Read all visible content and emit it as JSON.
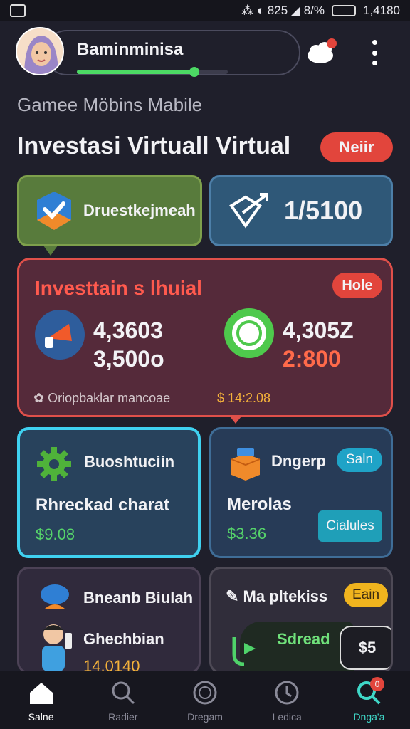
{
  "status_bar": {
    "icons_text": "⁂ ◐ 825 ◢ 8/%",
    "time": "1,4180"
  },
  "profile": {
    "name": "Baminminisa",
    "xp_progress": 0.78,
    "avatar_icon": "hijab-avatar"
  },
  "header": {
    "subtitle": "Gamee Möbins Mabile",
    "section_title": "Investasi Virtuall Virtual",
    "new_badge": "Neiir"
  },
  "top_cards": {
    "left_label": "Druestkejmeah",
    "left_icon": "shield-check-icon",
    "right_value": "1/5100",
    "right_icon": "shield-arrow-icon"
  },
  "investment_panel": {
    "title": "Investtain s lhuial",
    "badge": "Hole",
    "left_stat_a": "4,3603",
    "left_stat_b": "3,500o",
    "right_stat_a": "4,305Z",
    "right_stat_b": "2:800",
    "footer_left": "Oriopbaklar mancoae",
    "footer_right": "14:2.08"
  },
  "mid_cards": {
    "left": {
      "title": "Buoshtuciin",
      "line": "Rhreckad charat",
      "price": "$9.08"
    },
    "right": {
      "title": "Dngerp",
      "sale": "Saln",
      "line": "Merolas",
      "price": "$3.36",
      "button": "Cialules"
    }
  },
  "bottom_cards": {
    "left": {
      "title": "Bneanb Biulah",
      "line": "Ghechbian",
      "number": "14.0140"
    },
    "right": {
      "title": "Ma pltekiss",
      "badge": "Eain",
      "spread": "Sdread",
      "price": "$5"
    }
  },
  "bottom_nav": [
    {
      "label": "Salne",
      "icon": "home-icon"
    },
    {
      "label": "Radier",
      "icon": "search-icon"
    },
    {
      "label": "Dregam",
      "icon": "coin-icon"
    },
    {
      "label": "Ledica",
      "icon": "clock-icon"
    },
    {
      "label": "Dnga'a",
      "icon": "search-badge-icon",
      "badge": "0"
    }
  ],
  "colors": {
    "background": "#1f1f2b",
    "accent_red": "#e2453c",
    "accent_green": "#4cd964",
    "accent_cyan": "#3fd1f0"
  }
}
